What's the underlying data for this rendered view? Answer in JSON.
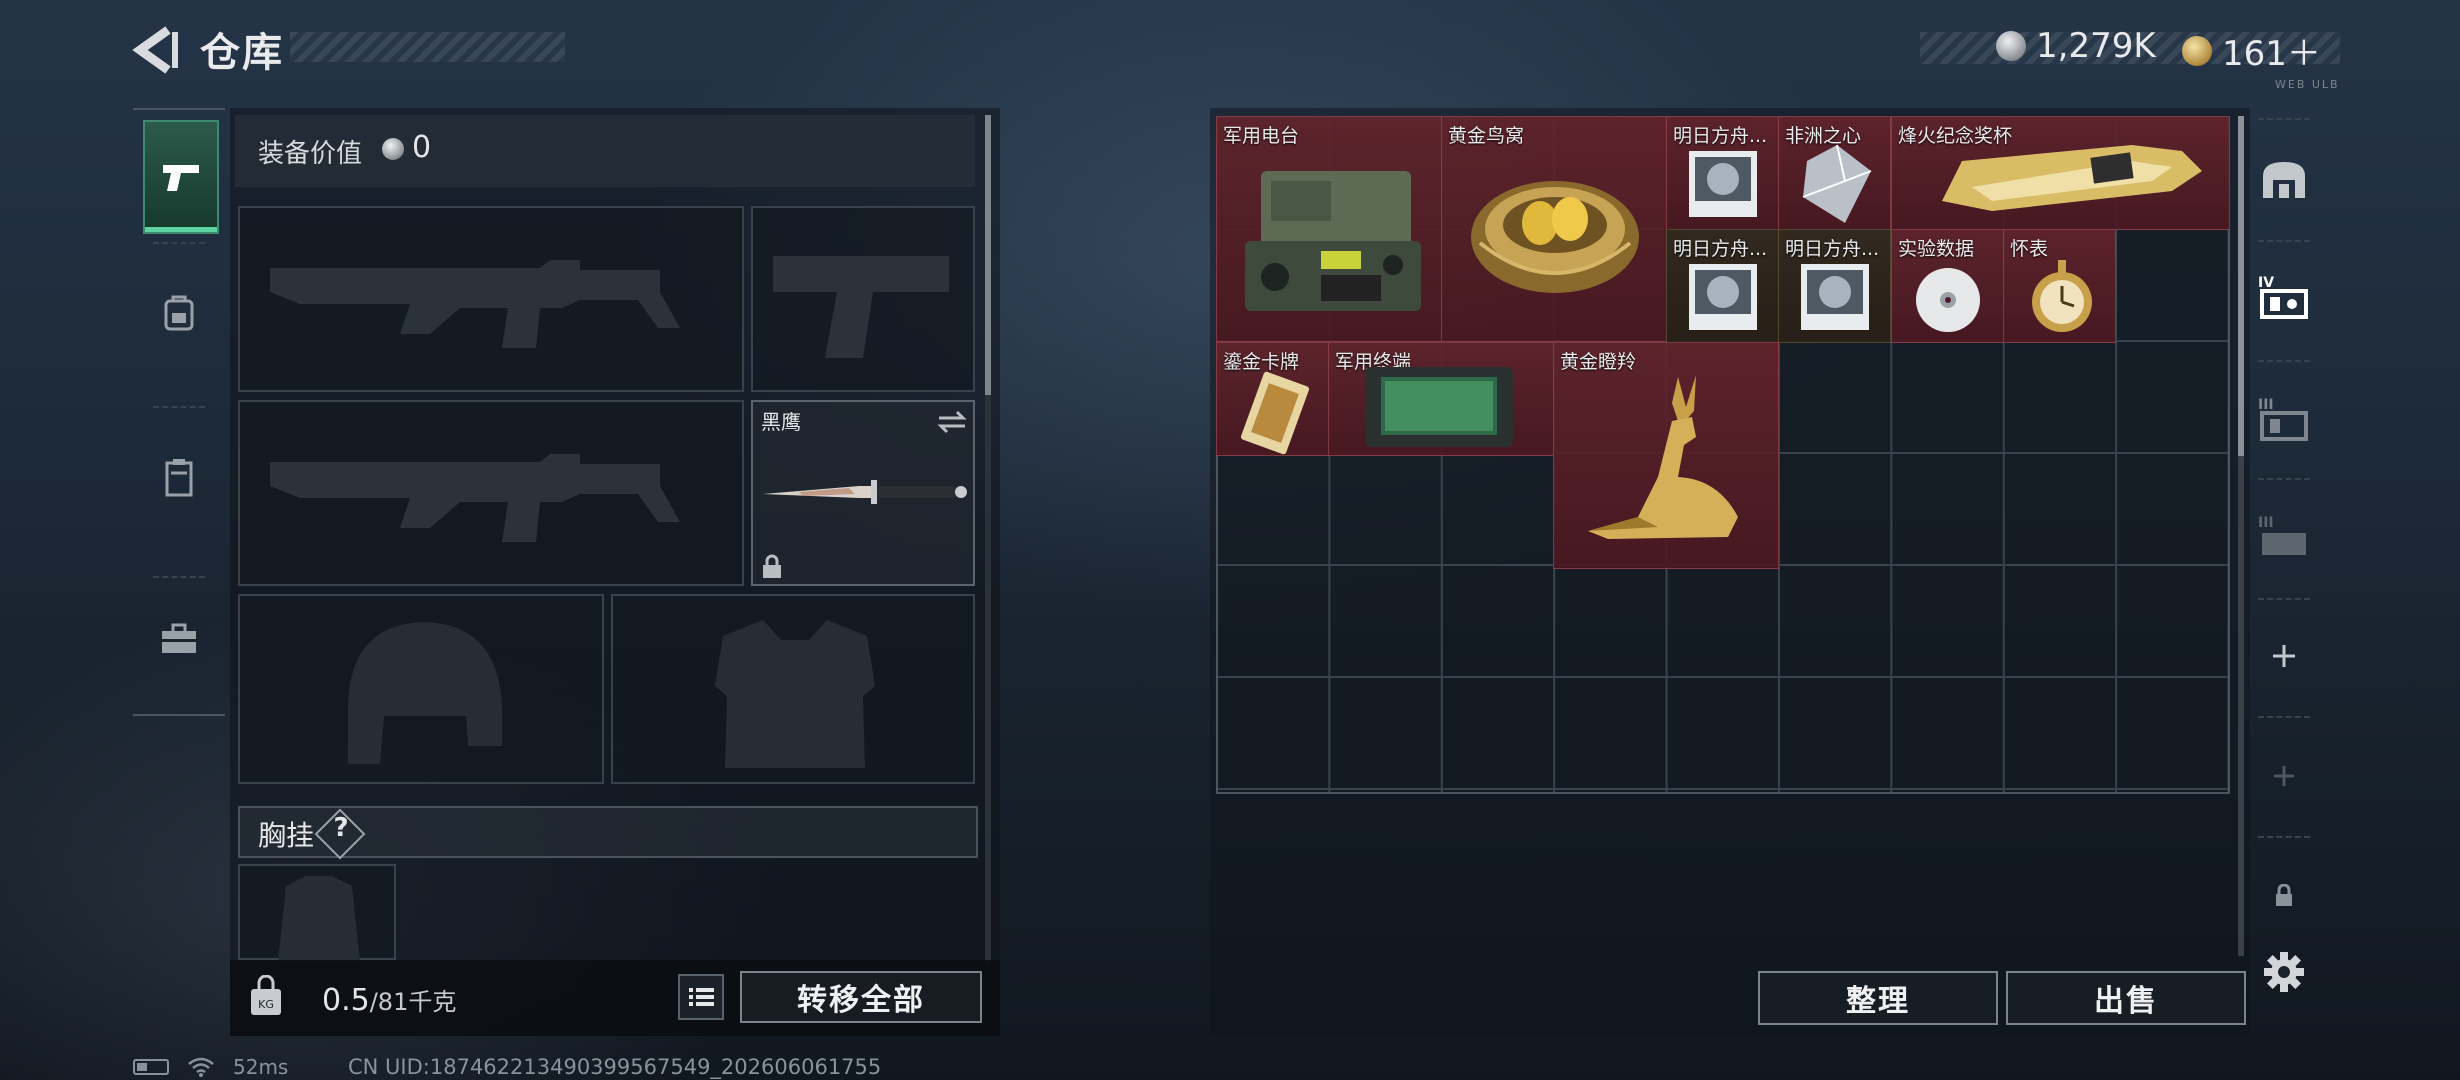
{
  "header": {
    "title": "仓库",
    "currency_silver": "1,279K",
    "currency_gold": "161＋",
    "version_tag": "WEB ULB"
  },
  "loadout": {
    "value_label": "装备价值",
    "value_amount": "0",
    "melee_name": "黑鹰",
    "chest_rig_label": "胸挂",
    "help_symbol": "?"
  },
  "capacity": {
    "current": "0.5",
    "max": "/81",
    "unit": "千克"
  },
  "buttons": {
    "transfer_all": "转移全部",
    "sort": "整理",
    "sell": "出售"
  },
  "storage_items": [
    {
      "name": "军用电台"
    },
    {
      "name": "黄金鸟窝"
    },
    {
      "name": "明日方舟..."
    },
    {
      "name": "非洲之心"
    },
    {
      "name": "烽火纪念奖杯"
    },
    {
      "name": "明日方舟..."
    },
    {
      "name": "明日方舟..."
    },
    {
      "name": "实验数据"
    },
    {
      "name": "怀表"
    },
    {
      "name": "鎏金卡牌"
    },
    {
      "name": "军用终端"
    },
    {
      "name": "黄金瞪羚"
    }
  ],
  "status": {
    "ping": "52ms",
    "uid": "CN UID:187462213490399567549_202606061755"
  },
  "colors": {
    "accent_green": "#5fd3a2",
    "item_red": "#62242c"
  },
  "icons": [
    "back-arrow-icon",
    "silver-coin-icon",
    "gold-coin-icon",
    "pistol-icon",
    "backpack-icon",
    "container-icon",
    "toolbox-icon",
    "swap-icon",
    "lock-icon",
    "weight-icon",
    "list-icon",
    "gear-icon",
    "plus-icon"
  ]
}
